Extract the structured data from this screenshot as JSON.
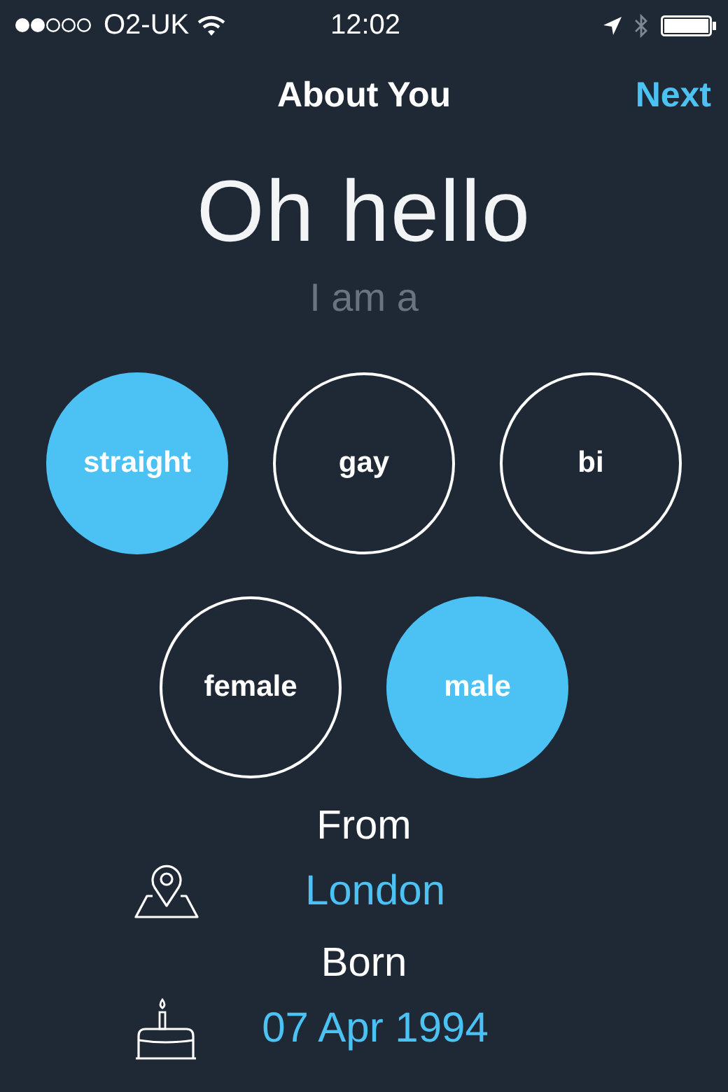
{
  "status_bar": {
    "carrier": "O2-UK",
    "time": "12:02"
  },
  "nav": {
    "title": "About You",
    "action": "Next"
  },
  "heading": "Oh hello",
  "prompt": "I am a",
  "orientation": [
    {
      "label": "straight",
      "selected": true
    },
    {
      "label": "gay",
      "selected": false
    },
    {
      "label": "bi",
      "selected": false
    }
  ],
  "gender": [
    {
      "label": "female",
      "selected": false
    },
    {
      "label": "male",
      "selected": true
    }
  ],
  "from": {
    "label": "From",
    "value": "London"
  },
  "born": {
    "label": "Born",
    "value": "07 Apr 1994"
  }
}
